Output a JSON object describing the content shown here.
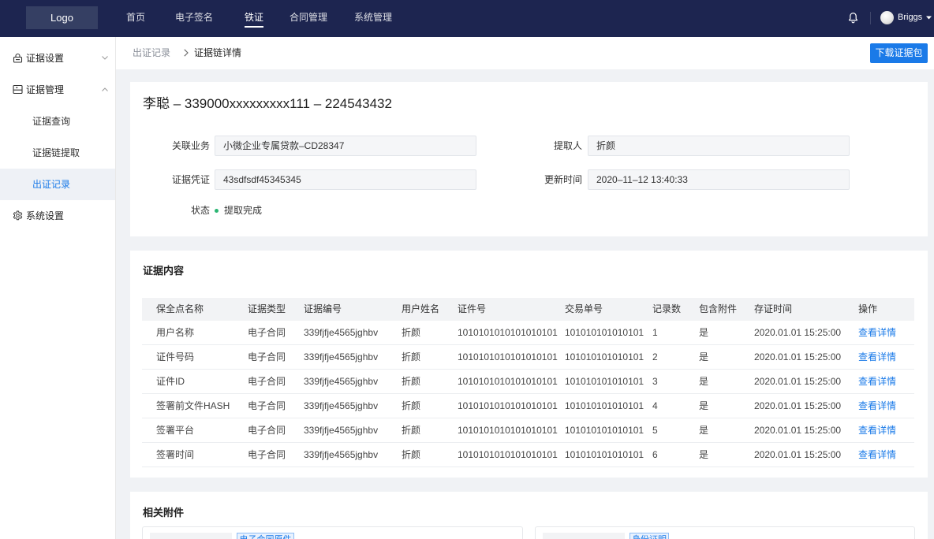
{
  "theme": {
    "topbar": "#1d2550",
    "logo_bg": "#353f63",
    "accent": "#1a7ae8",
    "success": "#2bb673"
  },
  "header": {
    "logo": "Logo",
    "nav": [
      {
        "label": "首页",
        "active": false
      },
      {
        "label": "电子签名",
        "active": false
      },
      {
        "label": "铁证",
        "active": true
      },
      {
        "label": "合同管理",
        "active": false
      },
      {
        "label": "系统管理",
        "active": false
      }
    ],
    "notifications_icon": "bell-icon",
    "user": {
      "name": "Briggs",
      "menu_icon": "caret-down-icon"
    }
  },
  "sidebar": {
    "items": [
      {
        "label": "证据设置",
        "icon": "lock-icon",
        "expanded": false
      },
      {
        "label": "证据管理",
        "icon": "archive-icon",
        "expanded": true,
        "children": [
          {
            "label": "证据查询",
            "active": false
          },
          {
            "label": "证据链提取",
            "active": false
          },
          {
            "label": "出证记录",
            "active": true
          }
        ]
      },
      {
        "label": "系统设置",
        "icon": "gear-icon",
        "expanded": false
      }
    ]
  },
  "breadcrumb": {
    "items": [
      {
        "label": "出证记录"
      },
      {
        "label": "证据链详情"
      }
    ],
    "separator_icon": "chevron-right-icon"
  },
  "toolbar": {
    "download_label": "下载证据包"
  },
  "detail": {
    "title": "李聪 – 339000xxxxxxxxx111 – 224543432",
    "fields": [
      {
        "label": "关联业务",
        "value": "小微企业专属贷款–CD28347"
      },
      {
        "label": "提取人",
        "value": "折颜"
      },
      {
        "label": "证据凭证",
        "value": "43sdfsdf45345345"
      },
      {
        "label": "更新时间",
        "value": "2020–11–12 13:40:33"
      }
    ],
    "status": {
      "label": "状态",
      "value": "提取完成"
    }
  },
  "evidence": {
    "title": "证据内容",
    "columns": [
      "保全点名称",
      "证据类型",
      "证据编号",
      "用户姓名",
      "证件号",
      "交易单号",
      "记录数",
      "包含附件",
      "存证时间",
      "操作"
    ],
    "rows": [
      {
        "name": "用户名称",
        "type": "电子合同",
        "code": "339fjfje4565jghbv",
        "user": "折颜",
        "id_no": "1010101010101010101",
        "trade_no": "101010101010101",
        "records": 1,
        "attachment": "是",
        "time": "2020.01.01 15:25:00",
        "action": "查看详情"
      },
      {
        "name": "证件号码",
        "type": "电子合同",
        "code": "339fjfje4565jghbv",
        "user": "折颜",
        "id_no": "1010101010101010101",
        "trade_no": "101010101010101",
        "records": 2,
        "attachment": "是",
        "time": "2020.01.01 15:25:00",
        "action": "查看详情"
      },
      {
        "name": "证件ID",
        "type": "电子合同",
        "code": "339fjfje4565jghbv",
        "user": "折颜",
        "id_no": "1010101010101010101",
        "trade_no": "101010101010101",
        "records": 3,
        "attachment": "是",
        "time": "2020.01.01 15:25:00",
        "action": "查看详情"
      },
      {
        "name": "签署前文件HASH",
        "type": "电子合同",
        "code": "339fjfje4565jghbv",
        "user": "折颜",
        "id_no": "1010101010101010101",
        "trade_no": "101010101010101",
        "records": 4,
        "attachment": "是",
        "time": "2020.01.01 15:25:00",
        "action": "查看详情"
      },
      {
        "name": "签署平台",
        "type": "电子合同",
        "code": "339fjfje4565jghbv",
        "user": "折颜",
        "id_no": "1010101010101010101",
        "trade_no": "101010101010101",
        "records": 5,
        "attachment": "是",
        "time": "2020.01.01 15:25:00",
        "action": "查看详情"
      },
      {
        "name": "签署时间",
        "type": "电子合同",
        "code": "339fjfje4565jghbv",
        "user": "折颜",
        "id_no": "1010101010101010101",
        "trade_no": "101010101010101",
        "records": 6,
        "attachment": "是",
        "time": "2020.01.01 15:25:00",
        "action": "查看详情"
      }
    ]
  },
  "attachments": {
    "title": "相关附件",
    "items": [
      {
        "tag": "电子合同原件"
      },
      {
        "tag": "身份证明"
      }
    ]
  }
}
